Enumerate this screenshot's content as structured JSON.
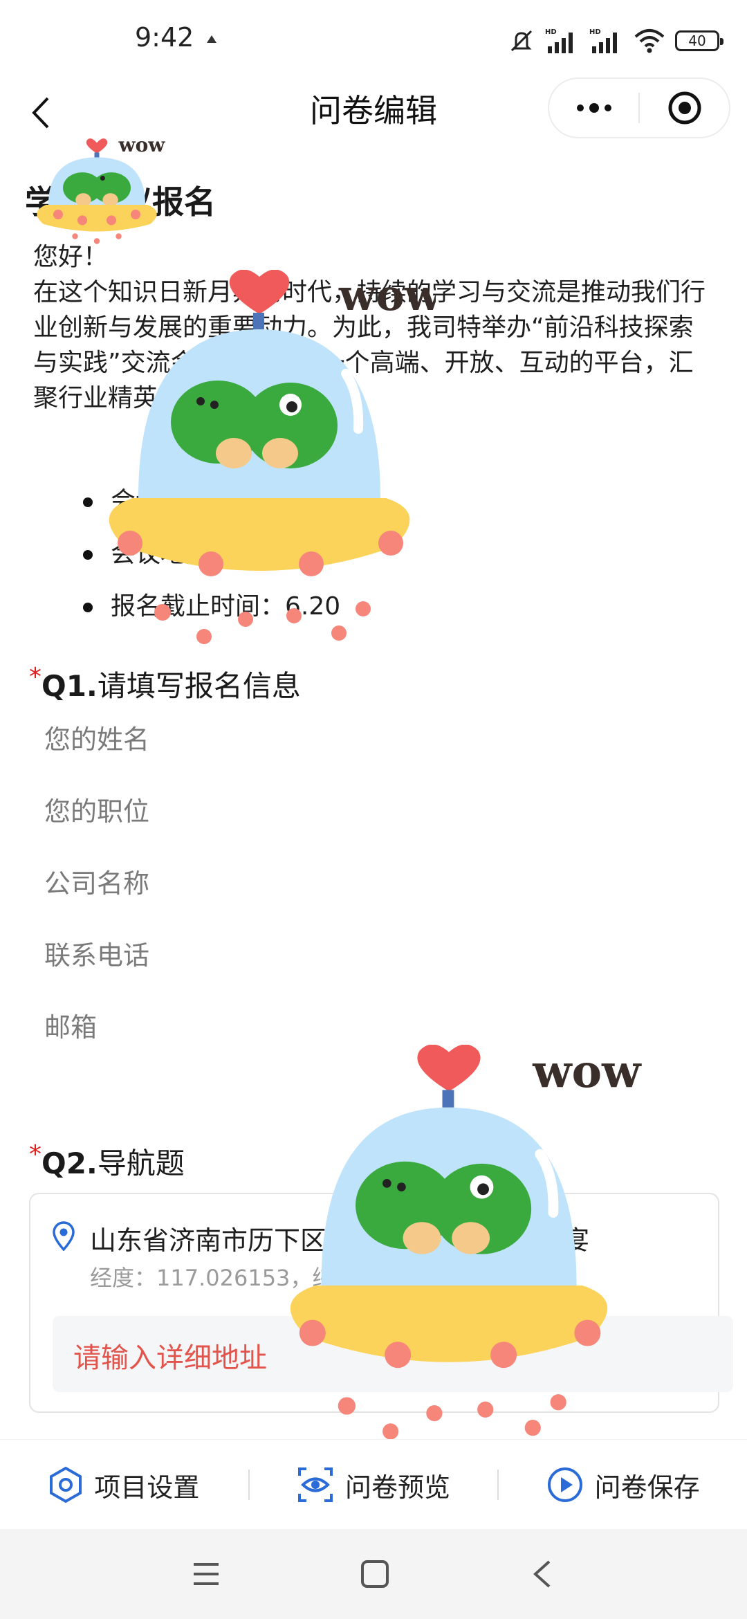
{
  "status_bar": {
    "time": "9:42",
    "battery": "40",
    "icons": [
      "notification-icon",
      "mute-icon",
      "hd-signal-icon",
      "hd-signal-icon",
      "wifi-icon",
      "battery-icon"
    ]
  },
  "nav": {
    "title": "问卷编辑",
    "back_icon": "back-chevron-icon",
    "more_icon": "more-dots-icon",
    "close_icon": "capsule-target-icon"
  },
  "survey": {
    "title": "学术会议报名",
    "intro_lines": [
      "您好！",
      "在这个知识日新月异的时代，持续的学习与交流是推动我们行业创新与发展的重要动力。为此，我司特举办“前沿科技探索与实践”交流会，旨在搭建一个高端、开放、互动的平台，汇聚行业精英，共谋发展大计。"
    ],
    "bullets": [
      "会议时间",
      "会议地点",
      "报名截止时间：6.20"
    ]
  },
  "q1": {
    "required_mark": "*",
    "number": "Q1.",
    "title": "请填写报名信息",
    "fields": [
      "您的姓名",
      "您的职位",
      "公司名称",
      "联系电话",
      "邮箱"
    ]
  },
  "q2": {
    "required_mark": "*",
    "number": "Q2.",
    "title": "导航题",
    "address": "山东省济南市历下区泉城路宽厚里泉城夜宴",
    "coordinate": "经度：117.026153，纬度：36.663526",
    "detail_placeholder": "请输入详细地址",
    "pin_icon": "location-pin-icon"
  },
  "toolbar": {
    "settings_label": "项目设置",
    "preview_label": "问卷预览",
    "save_label": "问卷保存",
    "icons": [
      "hexagon-settings-icon",
      "eye-preview-icon",
      "play-save-icon"
    ]
  },
  "system_nav": {
    "icons": [
      "menu-icon",
      "home-square-icon",
      "back-triangle-icon"
    ]
  },
  "stickers": {
    "text": "wow",
    "colors": {
      "dome": "#bfe3fb",
      "frog": "#3aaa3e",
      "saucer": "#fbd35a",
      "heart": "#f05a5a",
      "dots": "#f6857a"
    }
  }
}
